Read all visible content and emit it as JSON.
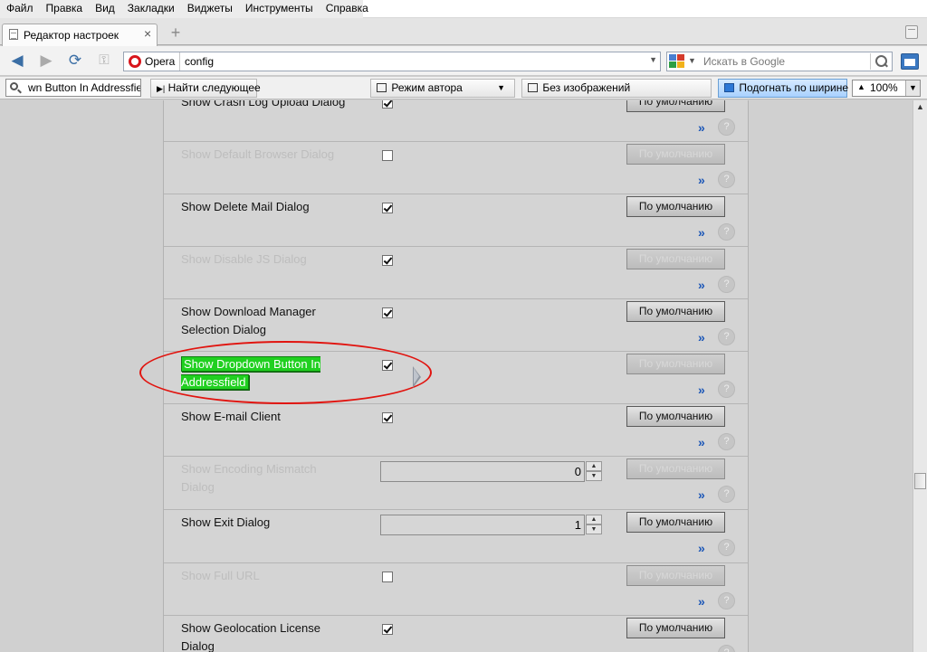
{
  "menu": [
    "Файл",
    "Правка",
    "Вид",
    "Закладки",
    "Виджеты",
    "Инструменты",
    "Справка"
  ],
  "tab": {
    "title": "Редактор настроек",
    "close": "×"
  },
  "newtab": "+",
  "address": {
    "site_label": "Opera",
    "url": "config"
  },
  "search": {
    "placeholder": "Искать в Google"
  },
  "find": {
    "value": "wn Button In Addressfield",
    "find_next": "Найти следующее"
  },
  "toolbar": {
    "author_mode": "Режим автора",
    "no_images": "Без изображений",
    "fit_width": "Подогнать по ширине",
    "zoom": "100%"
  },
  "buttons": {
    "default_label": "По умолчанию",
    "more": "»",
    "help": "?"
  },
  "rows": [
    {
      "label": "Show Crash Log Upload Dialog",
      "control": "checkbox",
      "checked": true,
      "dim": false,
      "default_enabled": true
    },
    {
      "label": "Show Default Browser Dialog",
      "control": "checkbox",
      "checked": false,
      "dim": true,
      "default_enabled": false
    },
    {
      "label": "Show Delete Mail Dialog",
      "control": "checkbox",
      "checked": true,
      "dim": false,
      "default_enabled": true
    },
    {
      "label": "Show Disable JS Dialog",
      "control": "checkbox",
      "checked": true,
      "dim": true,
      "default_enabled": false
    },
    {
      "label": "Show Download Manager Selection Dialog",
      "control": "checkbox",
      "checked": true,
      "dim": false,
      "default_enabled": true
    },
    {
      "label": "Show Dropdown Button In Addressfield",
      "control": "checkbox",
      "checked": true,
      "dim": false,
      "highlight": true,
      "default_enabled": false
    },
    {
      "label": "Show E-mail Client",
      "control": "checkbox",
      "checked": true,
      "dim": false,
      "default_enabled": true
    },
    {
      "label": "Show Encoding Mismatch Dialog",
      "control": "number",
      "value": "0",
      "dim": true,
      "default_enabled": false
    },
    {
      "label": "Show Exit Dialog",
      "control": "number",
      "value": "1",
      "dim": false,
      "default_enabled": true
    },
    {
      "label": "Show Full URL",
      "control": "checkbox",
      "checked": false,
      "dim": true,
      "default_enabled": false
    },
    {
      "label": "Show Geolocation License Dialog",
      "control": "checkbox",
      "checked": true,
      "dim": false,
      "default_enabled": true
    }
  ]
}
